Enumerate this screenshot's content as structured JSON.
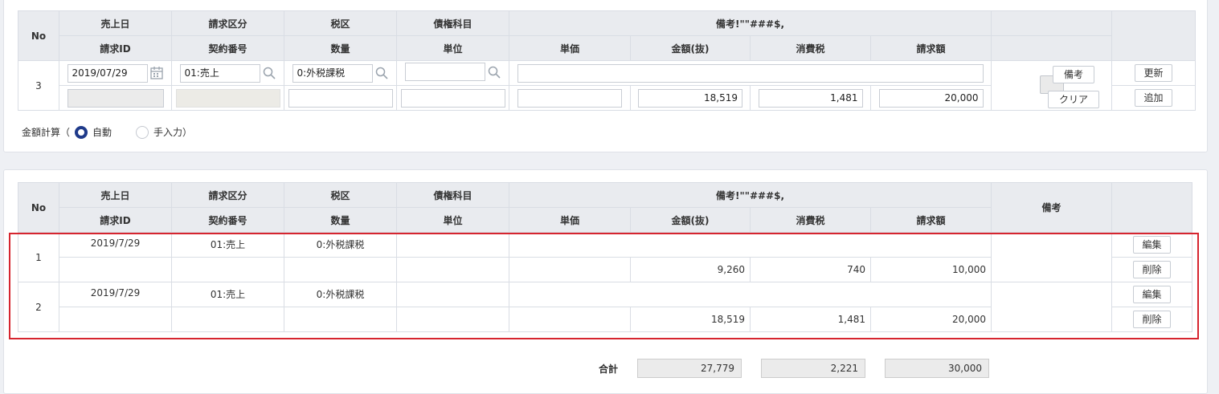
{
  "headers": {
    "no": "No",
    "sales_date": "売上日",
    "billing_type": "請求区分",
    "tax_type": "税区",
    "credit_item": "債権科目",
    "remarks_group": "備考!\"\"###$,",
    "billing_id": "請求ID",
    "contract_no": "契約番号",
    "quantity": "数量",
    "unit": "単位",
    "unit_price": "単価",
    "amount_ex_tax": "金額(抜)",
    "consumption_tax": "消費税",
    "billed_amount": "請求額",
    "remarks": "備考"
  },
  "entry": {
    "no": "3",
    "sales_date": "2019/07/29",
    "billing_type": "01:売上",
    "tax_type": "0:外税課税",
    "credit_item": "",
    "remarks_text": "",
    "billing_id": "",
    "contract_no": "",
    "quantity": "",
    "unit": "",
    "unit_price": "",
    "amount_ex_tax": "18,519",
    "consumption_tax": "1,481",
    "billed_amount": "20,000",
    "btn_remarks": "備考",
    "btn_update": "更新",
    "btn_clear": "クリア",
    "btn_add": "追加"
  },
  "calc_mode": {
    "label": "金額計算（",
    "auto": "自動",
    "manual": "手入力）",
    "selected": "auto"
  },
  "rows": [
    {
      "no": "1",
      "sales_date": "2019/7/29",
      "billing_type": "01:売上",
      "tax_type": "0:外税課税",
      "amount_ex_tax": "9,260",
      "consumption_tax": "740",
      "billed_amount": "10,000",
      "btn_edit": "編集",
      "btn_delete": "削除"
    },
    {
      "no": "2",
      "sales_date": "2019/7/29",
      "billing_type": "01:売上",
      "tax_type": "0:外税課税",
      "amount_ex_tax": "18,519",
      "consumption_tax": "1,481",
      "billed_amount": "20,000",
      "btn_edit": "編集",
      "btn_delete": "削除"
    }
  ],
  "totals": {
    "label": "合計",
    "amount_ex_tax": "27,779",
    "consumption_tax": "2,221",
    "billed_amount": "30,000"
  },
  "colors": {
    "highlight": "#d6252f",
    "radio_selected": "#1f3a8a",
    "header_bg": "#e9ebef"
  }
}
